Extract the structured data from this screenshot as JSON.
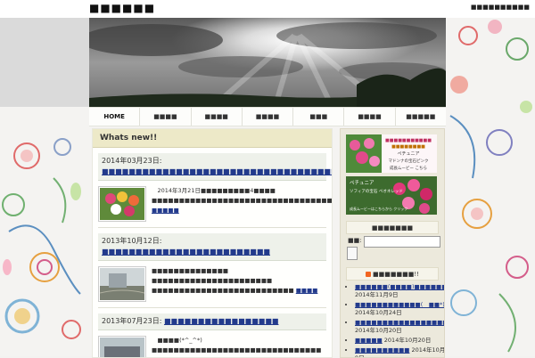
{
  "site": {
    "title": "■■■■■■",
    "top_right": "■■■■■■■■■■"
  },
  "nav": {
    "items": [
      "HOME",
      "■■■■",
      "■■■■",
      "■■■■",
      "■■■",
      "■■■■",
      "■■■■■"
    ]
  },
  "main": {
    "heading": "Whats new!!",
    "posts": [
      {
        "date": "2014年03月23日: ",
        "title": "■■■■■■■■■■■■■■■■■■■■■■■■■■■■■■■■■■■■■■■■■■■■■■■■",
        "excerpt": "　2014年3月21日■■■■■■■■■4■■■■ ■■■■■■■■■■■■■■■■■■■■■■■■■■■■■■■■■■",
        "more": "…■■■■■"
      },
      {
        "date": "2013年10月12日: ",
        "title": "■■■■■■■■■■■■■■■■■■■■■■■■■",
        "excerpt": "■■■■■■■■■■■■■■ ■■■■■■■■■■■■■■■■■■■■■■ ■■■■■■■■■■■■■■■■■■■■■■■■■■",
        "more": "■■■■"
      },
      {
        "date": "2013年07月23日: ",
        "title": "■■■■■■■■■■■■■■■■■",
        "excerpt": "　■■■■(*^_^*) ■■■■■■■■■■■■■■■■■■■■■■■■■■■■■■■ ■■■■■■■■ ■■■■■■ ■■■■■■■■",
        "more": "…■■■■■"
      }
    ]
  },
  "sidebar": {
    "banner1": {
      "line1": "■■■■■■■■■■■",
      "line2": "■■■■■■■■",
      "line3": "ペチュニア",
      "line4": "マドンナの宝石ピンク",
      "line5": "成長ムービー こちら"
    },
    "banner2": {
      "line1": "ペチュニア",
      "line2": "ソフィアの宝石 ベオネレッド",
      "line3": "成長ムービーはこちらから クリック"
    },
    "search_head": "■■■■■■■",
    "search_label": "■■:",
    "recent_head": "■■■■■■■!!",
    "recent": [
      {
        "title": "■■■■■■(■■■■)■■■■■■",
        "date": " 2014年11月9日"
      },
      {
        "title": "■■■■■■■■■■■■(　■■*)",
        "date": " 2014年10月24日"
      },
      {
        "title": "■■■■■■■■■■■■■■■■■■(■■■■)■■■■",
        "date": " 2014年10月20日"
      },
      {
        "title": "■■■■■",
        "date": " 2014年10月20日"
      },
      {
        "title": "■■■■■■■■■■",
        "date": " 2014年10月9日"
      }
    ]
  },
  "colors": {
    "link": "#223a8c",
    "heading_bg": "#ede9c8"
  }
}
